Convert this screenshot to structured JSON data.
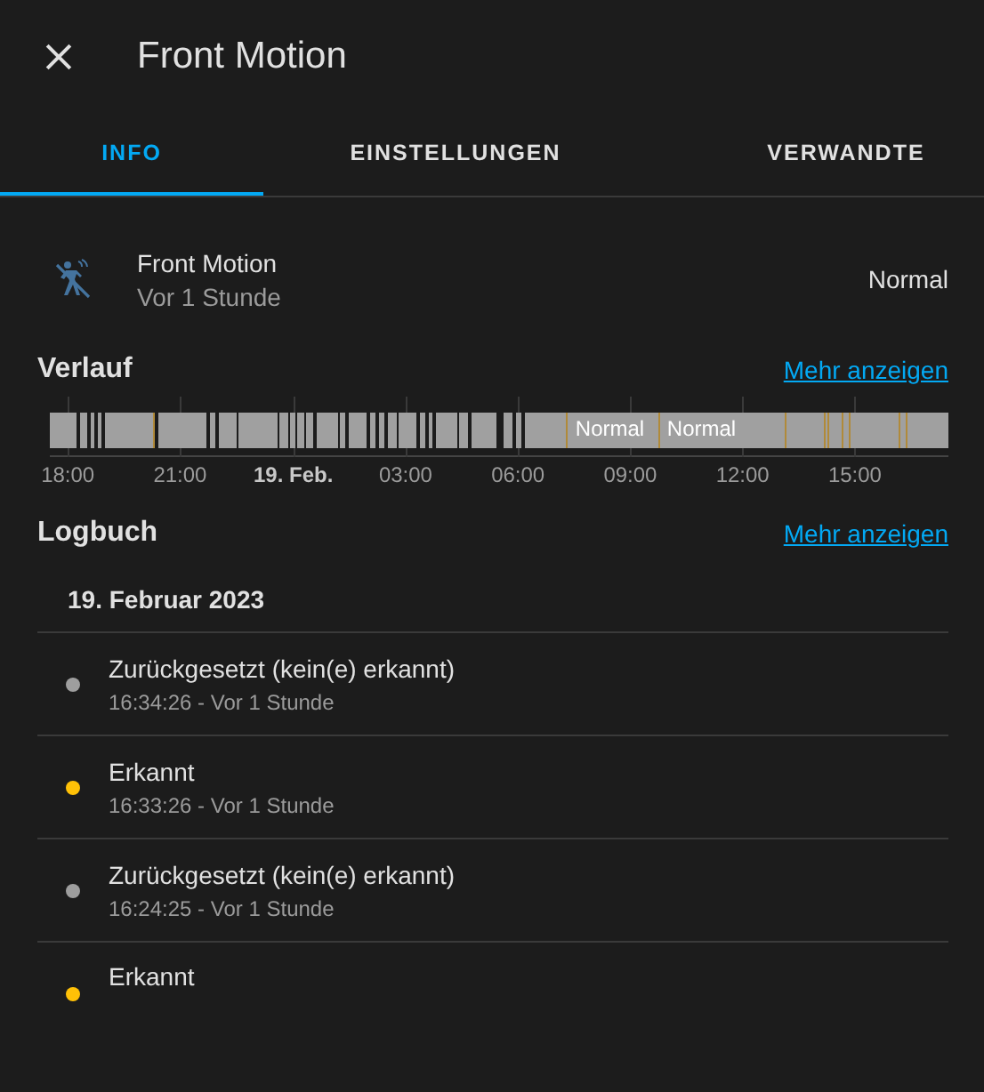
{
  "dialog": {
    "title": "Front Motion"
  },
  "tabs": [
    {
      "label": "INFO",
      "selected": true
    },
    {
      "label": "EINSTELLUNGEN",
      "selected": false
    },
    {
      "label": "VERWANDTE",
      "selected": false
    }
  ],
  "entity": {
    "name": "Front Motion",
    "secondary": "Vor 1 Stunde",
    "state": "Normal"
  },
  "history": {
    "title": "Verlauf",
    "link": "Mehr anzeigen",
    "bar_labels": [
      "Normal",
      "Normal"
    ],
    "ticks": [
      {
        "label": "18:00",
        "bold": false
      },
      {
        "label": "21:00",
        "bold": false
      },
      {
        "label": "19. Feb.",
        "bold": true
      },
      {
        "label": "03:00",
        "bold": false
      },
      {
        "label": "06:00",
        "bold": false
      },
      {
        "label": "09:00",
        "bold": false
      },
      {
        "label": "12:00",
        "bold": false
      },
      {
        "label": "15:00",
        "bold": false
      }
    ]
  },
  "logbook": {
    "title": "Logbuch",
    "link": "Mehr anzeigen",
    "date": "19. Februar 2023",
    "entries": [
      {
        "message": "Zurückgesetzt (kein(e) erkannt)",
        "time": "16:34:26 - Vor 1 Stunde",
        "color": "#9e9e9e"
      },
      {
        "message": "Erkannt",
        "time": "16:33:26 - Vor 1 Stunde",
        "color": "#ffc107"
      },
      {
        "message": "Zurückgesetzt (kein(e) erkannt)",
        "time": "16:24:25 - Vor 1 Stunde",
        "color": "#9e9e9e"
      },
      {
        "message": "Erkannt",
        "color": "#ffc107"
      }
    ]
  }
}
